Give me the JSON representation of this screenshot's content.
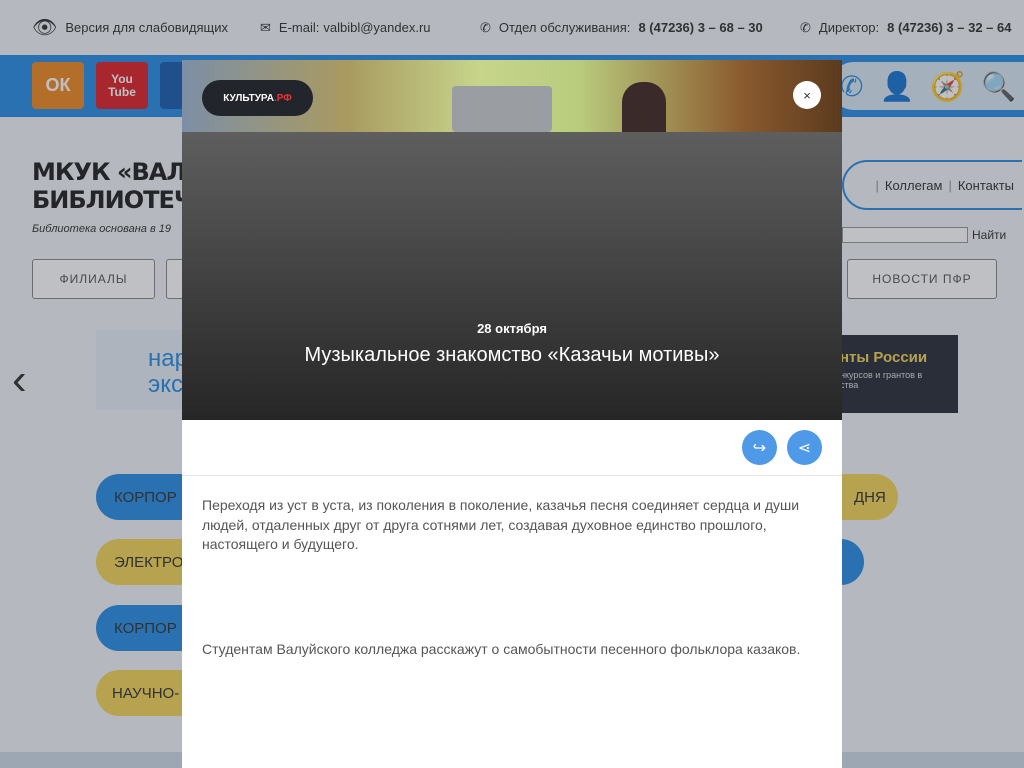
{
  "topbar": {
    "low_vision": "Версия для слабовидящих",
    "email_label": "E-mail:",
    "email": "valbibl@yandex.ru",
    "service_label": "Отдел обслуживания:",
    "service_phone": "8 (47236) 3 – 68 – 30",
    "director_label": "Директор:",
    "director_phone": "8 (47236) 3 – 32 – 64"
  },
  "social": {
    "ok": "ОК",
    "youtube": "You Tube"
  },
  "site": {
    "title_line1": "МКУК «ВАЛУЙСК",
    "title_line2": "БИБЛИОТЕЧНАЯ С",
    "subtitle": "Библиотека основана в 19",
    "nav": [
      "Коллегам",
      "Контакты"
    ],
    "search_button": "Найти",
    "buttons": [
      "ФИЛИАЛЫ",
      "НОВОСТИ ПФР"
    ],
    "banner_left": [
      "нар",
      "экс"
    ],
    "banner_right": {
      "title": "нты России",
      "text": "нкурсов и грантов в ства"
    },
    "pills": [
      "КОРПОР",
      "ЭЛЕКТРО",
      "КОРПОР",
      "НАУЧНО-",
      "ДНЯ"
    ]
  },
  "modal": {
    "logo": "КУЛЬТУРА",
    "logo_suffix": ".РФ",
    "close": "×",
    "date": "28 октября",
    "title": "Музыкальное знакомство «Казачьи мотивы»",
    "paragraphs": [
      "Переходя из уст в уста, из поколения в поколение, казачья песня соединяет сердца и души людей, отдаленных друг от друга сотнями лет, создавая духовное единство прошлого, настоящего и будущего.",
      "Студентам Валуйского колледжа расскажут о самобытности песенного фольклора казаков."
    ]
  },
  "colors": {
    "accent": "#2b8ee6",
    "yellow": "#f5d45a",
    "action": "#4e99e8"
  }
}
